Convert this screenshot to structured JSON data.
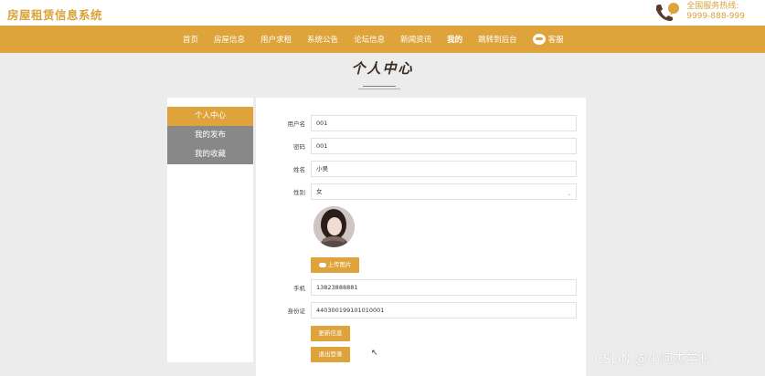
{
  "header": {
    "logo": "房屋租赁信息系统",
    "hotline_label": "全国服务热线:",
    "hotline_number": "9999-888-999"
  },
  "nav": {
    "items": [
      "首页",
      "房屋信息",
      "用户求租",
      "系统公告",
      "论坛信息",
      "新闻资讯",
      "我的",
      "跳转到后台"
    ],
    "active": "我的",
    "kefu": "客服"
  },
  "page": {
    "title": "个人中心"
  },
  "sidebar": {
    "items": [
      "个人中心",
      "我的发布",
      "我的收藏"
    ]
  },
  "form": {
    "username": {
      "label": "用户名",
      "value": "001"
    },
    "password": {
      "label": "密码",
      "value": "001"
    },
    "name": {
      "label": "姓名",
      "value": "小吴"
    },
    "gender": {
      "label": "性别",
      "value": "女"
    },
    "upload_label": "上传图片",
    "phone": {
      "label": "手机",
      "value": "13823888881"
    },
    "idcard": {
      "label": "身份证",
      "value": "440300199101010001"
    },
    "save_label": "更新信息",
    "logout_label": "退出登录"
  },
  "watermark": "CSDN @小阿杰学长",
  "colors": {
    "accent": "#dfa33b",
    "sidebar_inactive": "#888888"
  }
}
